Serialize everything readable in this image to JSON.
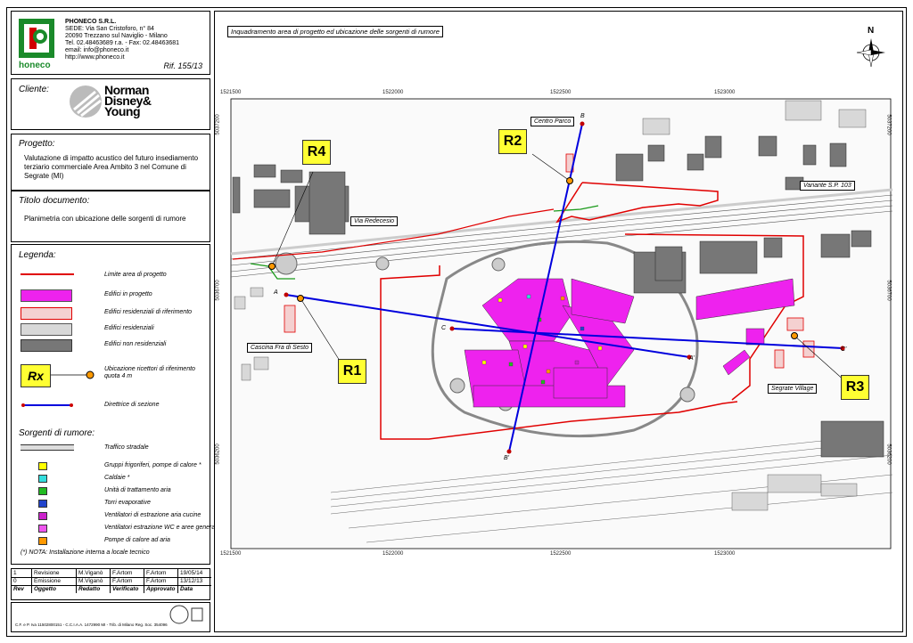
{
  "company": {
    "name": "PHONECO S.R.L.",
    "address1": "SEDE: Via San Cristoforo, n° 84",
    "address2": "20090 Trezzano sul Naviglio - Milano",
    "phone": "Tel. 02.48463689 r.a. - Fax: 02.48463681",
    "email": "email: info@phoneco.it",
    "web": "http://www.phoneco.it",
    "logo_text": "honeco",
    "ref": "Rif. 155/13"
  },
  "client": {
    "label": "Cliente:",
    "logo_line1": "Norman",
    "logo_line2": "Disney&",
    "logo_line3": "Young"
  },
  "project": {
    "label": "Progetto:",
    "text": "Valutazione di impatto acustico del futuro insediamento terziario commerciale Area Ambito 3 nel Comune di Segrate (MI)"
  },
  "document": {
    "label": "Titolo documento:",
    "text": "Planimetria con ubicazione delle sorgenti di rumore"
  },
  "legend": {
    "label": "Legenda:",
    "items": [
      {
        "label": "Limite area di progetto"
      },
      {
        "label": "Edifici in progetto"
      },
      {
        "label": "Edifici residenziali di riferimento"
      },
      {
        "label": "Edifici residenziali"
      },
      {
        "label": "Edifici non residenziali"
      },
      {
        "label": "Ubicazione ricettori di riferimento quota 4 m",
        "symbol": "Rx"
      },
      {
        "label": "Direttrice di sezione"
      }
    ]
  },
  "sources": {
    "label": "Sorgenti di rumore:",
    "road": "Traffico stradale",
    "items": [
      {
        "label": "Gruppi frigoriferi, pompe di calore *",
        "color": "#ffff00"
      },
      {
        "label": "Caldaie *",
        "color": "#33dddd"
      },
      {
        "label": "Unità di trattamento aria",
        "color": "#22bb22"
      },
      {
        "label": "Torri evaporative",
        "color": "#2244cc"
      },
      {
        "label": "Ventilatori di estrazione aria cucine",
        "color": "#cc22cc"
      },
      {
        "label": "Ventilatori estrazione WC e aree generali",
        "color": "#ee55ee"
      },
      {
        "label": "Pompe di calore ad aria",
        "color": "#ff9900"
      }
    ],
    "note": "(*) NOTA: Installazione interna a locale tecnico"
  },
  "revisions": {
    "rows": [
      [
        "1",
        "Revisione",
        "M.Viganò",
        "F.Artom",
        "F.Artom",
        "19/05/14"
      ],
      [
        "0",
        "Emissione",
        "M.Viganò",
        "F.Artom",
        "F.Artom",
        "13/12/13"
      ]
    ],
    "header": [
      "Rev",
      "Oggetto",
      "Redatto",
      "Verificato",
      "Approvato",
      "Data"
    ]
  },
  "footer": "C.F. e P. Iva 11502800151 - C.C.I.A.A. 1472990 MI - Trib. di Milano Reg. Soc. 354096",
  "map": {
    "title": "Inquadramento area di progetto ed ubicazione delle sorgenti di rumore",
    "north": "N",
    "coords_top": [
      "1521500",
      "1522000",
      "1522500",
      "1523000"
    ],
    "coords_bottom": [
      "1521500",
      "1522000",
      "1522500",
      "1523000"
    ],
    "coords_left": [
      "5037200",
      "5036700",
      "5036200"
    ],
    "coords_right": [
      "5037200",
      "5036700",
      "5036200"
    ],
    "labels": {
      "centro_parco": "Centro Parco",
      "variante": "Variante S.P. 103",
      "via_redecesio": "Via Redecesio",
      "cascina": "Cascina Fra di Sesto",
      "segrate_village": "Segrate Village"
    },
    "receptors": [
      "R1",
      "R2",
      "R3",
      "R4"
    ],
    "section_points": [
      "A",
      "A'",
      "B",
      "B'",
      "C",
      "C'"
    ]
  },
  "colors": {
    "project_limit": "#e00000",
    "planned_buildings": "#ee22ee",
    "section_line": "#0000dd",
    "receptor_fill": "#ffff33"
  }
}
